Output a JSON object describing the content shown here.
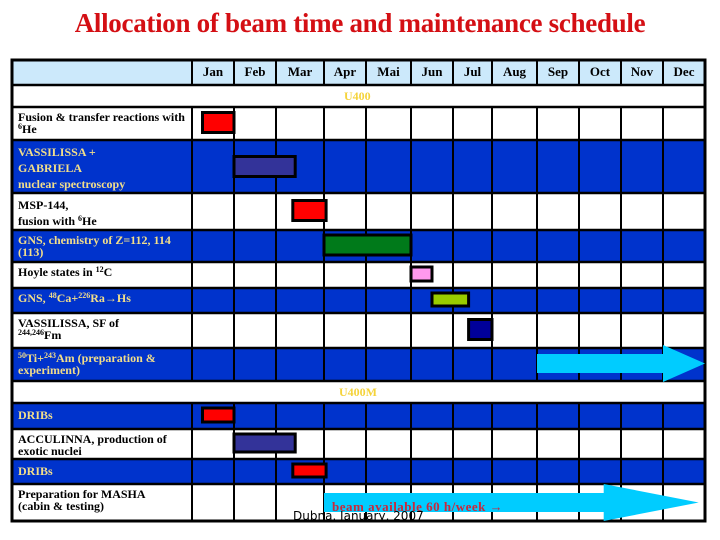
{
  "title": "Allocation of beam time and maintenance schedule",
  "chart_data": {
    "type": "gantt",
    "title": "Allocation of beam time and maintenance schedule",
    "months": [
      "Jan",
      "Feb",
      "Mar",
      "Apr",
      "Mai",
      "Jun",
      "Jul",
      "Aug",
      "Sep",
      "Oct",
      "Nov",
      "Dec"
    ],
    "sections": [
      {
        "name": "U400",
        "rows": [
          {
            "label_html": "Fusion &amp; transfer reactions with <sup>6</sup>He",
            "label": "Fusion & transfer reactions with 6He",
            "style": "white",
            "bar": {
              "start": 0.25,
              "end": 1.0,
              "color": "#ff0000",
              "kind": "box"
            }
          },
          {
            "label_html": "VASSILISSA +<br>GABRIELA<br>nuclear spectroscopy",
            "label": "VASSILISSA + GABRIELA nuclear spectroscopy",
            "style": "blue",
            "bar": {
              "start": 1.0,
              "end": 2.4,
              "color": "#333399",
              "kind": "box"
            }
          },
          {
            "label_html": "MSP-144,<br>fusion with <sup>6</sup>He",
            "label": "MSP-144, fusion with 6He",
            "style": "white",
            "bar": {
              "start": 2.35,
              "end": 3.05,
              "color": "#ff0000",
              "kind": "box"
            }
          },
          {
            "label_html": "GNS, chemistry of Z=112, 114 (113)",
            "label": "GNS, chemistry of Z=112, 114 (113)",
            "style": "blue",
            "bar": {
              "start": 3.0,
              "end": 5.0,
              "color": "#007a1a",
              "kind": "box"
            }
          },
          {
            "label_html": "Hoyle states in <sup>12</sup>C",
            "label": "Hoyle states in 12C",
            "style": "white",
            "bar": {
              "start": 5.0,
              "end": 5.5,
              "color": "#ff99ee",
              "kind": "box"
            }
          },
          {
            "label_html": "GNS, <sup>48</sup>Ca+<sup>226</sup>Ra&rarr;Hs",
            "label": "GNS, 48Ca+226Ra→Hs",
            "style": "blue",
            "bar": {
              "start": 5.5,
              "end": 6.4,
              "color": "#99cc00",
              "kind": "box"
            }
          },
          {
            "label_html": "VASSILISSA, SF of<br><sup>244,246</sup>Fm",
            "label": "VASSILISSA, SF of 244,246Fm",
            "style": "white",
            "bar": {
              "start": 6.4,
              "end": 7.0,
              "color": "#000099",
              "kind": "box"
            }
          },
          {
            "label_html": "<sup>50</sup>Ti+<sup>243</sup>Am (preparation &amp; experiment)",
            "label": "50Ti+243Am (preparation & experiment)",
            "style": "blue",
            "bar": {
              "start": 8.0,
              "end": 12.0,
              "color": "#00ccff",
              "kind": "arrow"
            }
          }
        ]
      },
      {
        "name": "U400M",
        "rows": [
          {
            "label_html": "DRIBs",
            "label": "DRIBs",
            "style": "blue",
            "bar": {
              "start": 0.25,
              "end": 1.0,
              "color": "#ff0000",
              "kind": "box"
            }
          },
          {
            "label_html": "ACCULINNA, production of exotic nuclei",
            "label": "ACCULINNA, production of exotic nuclei",
            "style": "white",
            "bar": {
              "start": 1.0,
              "end": 2.4,
              "color": "#333399",
              "kind": "box"
            }
          },
          {
            "label_html": "DRIBs",
            "label": "DRIBs",
            "style": "blue",
            "bar": {
              "start": 2.35,
              "end": 3.05,
              "color": "#ff0000",
              "kind": "box"
            }
          },
          {
            "label_html": "Preparation for MASHA<br>(cabin &amp; testing)",
            "label": "Preparation for MASHA (cabin & testing)",
            "style": "white",
            "bar": {
              "start": 3.0,
              "end": 11.85,
              "color": "#00ccff",
              "kind": "arrow"
            }
          }
        ]
      }
    ],
    "annotations": [
      {
        "text": "beam available 60 h/week →",
        "row": "Preparation for MASHA (cabin & testing)"
      }
    ]
  },
  "colors": {
    "title": "#d40f14",
    "header_bg": "#cce9fb",
    "row_blue": "#0033cc",
    "row_white": "#ffffff",
    "section_label": "#f5d33a",
    "light_text": "#f2de8a",
    "grid": "#000000"
  },
  "beam_note": "beam available 60 h/week →",
  "footer": "Dubna, January, 2007"
}
